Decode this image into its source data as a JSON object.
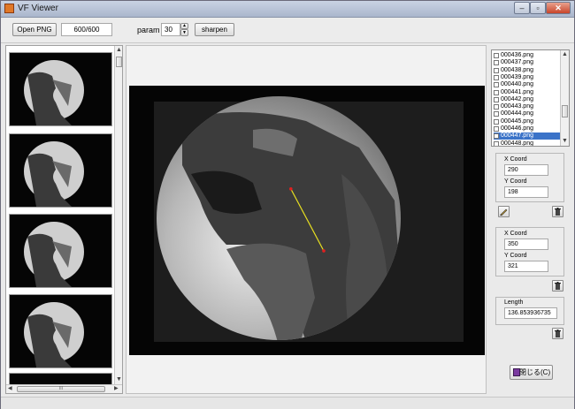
{
  "window": {
    "title": "VF Viewer"
  },
  "titlebar_buttons": {
    "minimize": "‒",
    "maximize": "▫",
    "close": "✕"
  },
  "toolbar": {
    "open_label": "Open PNG",
    "frame_counter": "600/600",
    "param_label": "param",
    "param_value": "30",
    "sharpen_label": "sharpen"
  },
  "thumbnails": {
    "count": 4
  },
  "scroll_symbols": {
    "up": "▲",
    "down": "▼",
    "left": "◀",
    "right": "▶",
    "grip": "III"
  },
  "file_list": {
    "items": [
      "000436.png",
      "000437.png",
      "000438.png",
      "000439.png",
      "000440.png",
      "000441.png",
      "000442.png",
      "000443.png",
      "000444.png",
      "000445.png",
      "000446.png",
      "000447.png",
      "000448.png"
    ],
    "selected": "000447.png"
  },
  "point1": {
    "x_label": "X Coord",
    "x_value": "290",
    "y_label": "Y Coord",
    "y_value": "198"
  },
  "point2": {
    "x_label": "X Coord",
    "x_value": "350",
    "y_label": "Y Coord",
    "y_value": "321"
  },
  "length": {
    "label": "Length",
    "value": "136.853936735"
  },
  "close_button": {
    "label": "閉じる(C)"
  },
  "measure": {
    "line_color": "#e8e020",
    "point_color": "#e02020"
  }
}
